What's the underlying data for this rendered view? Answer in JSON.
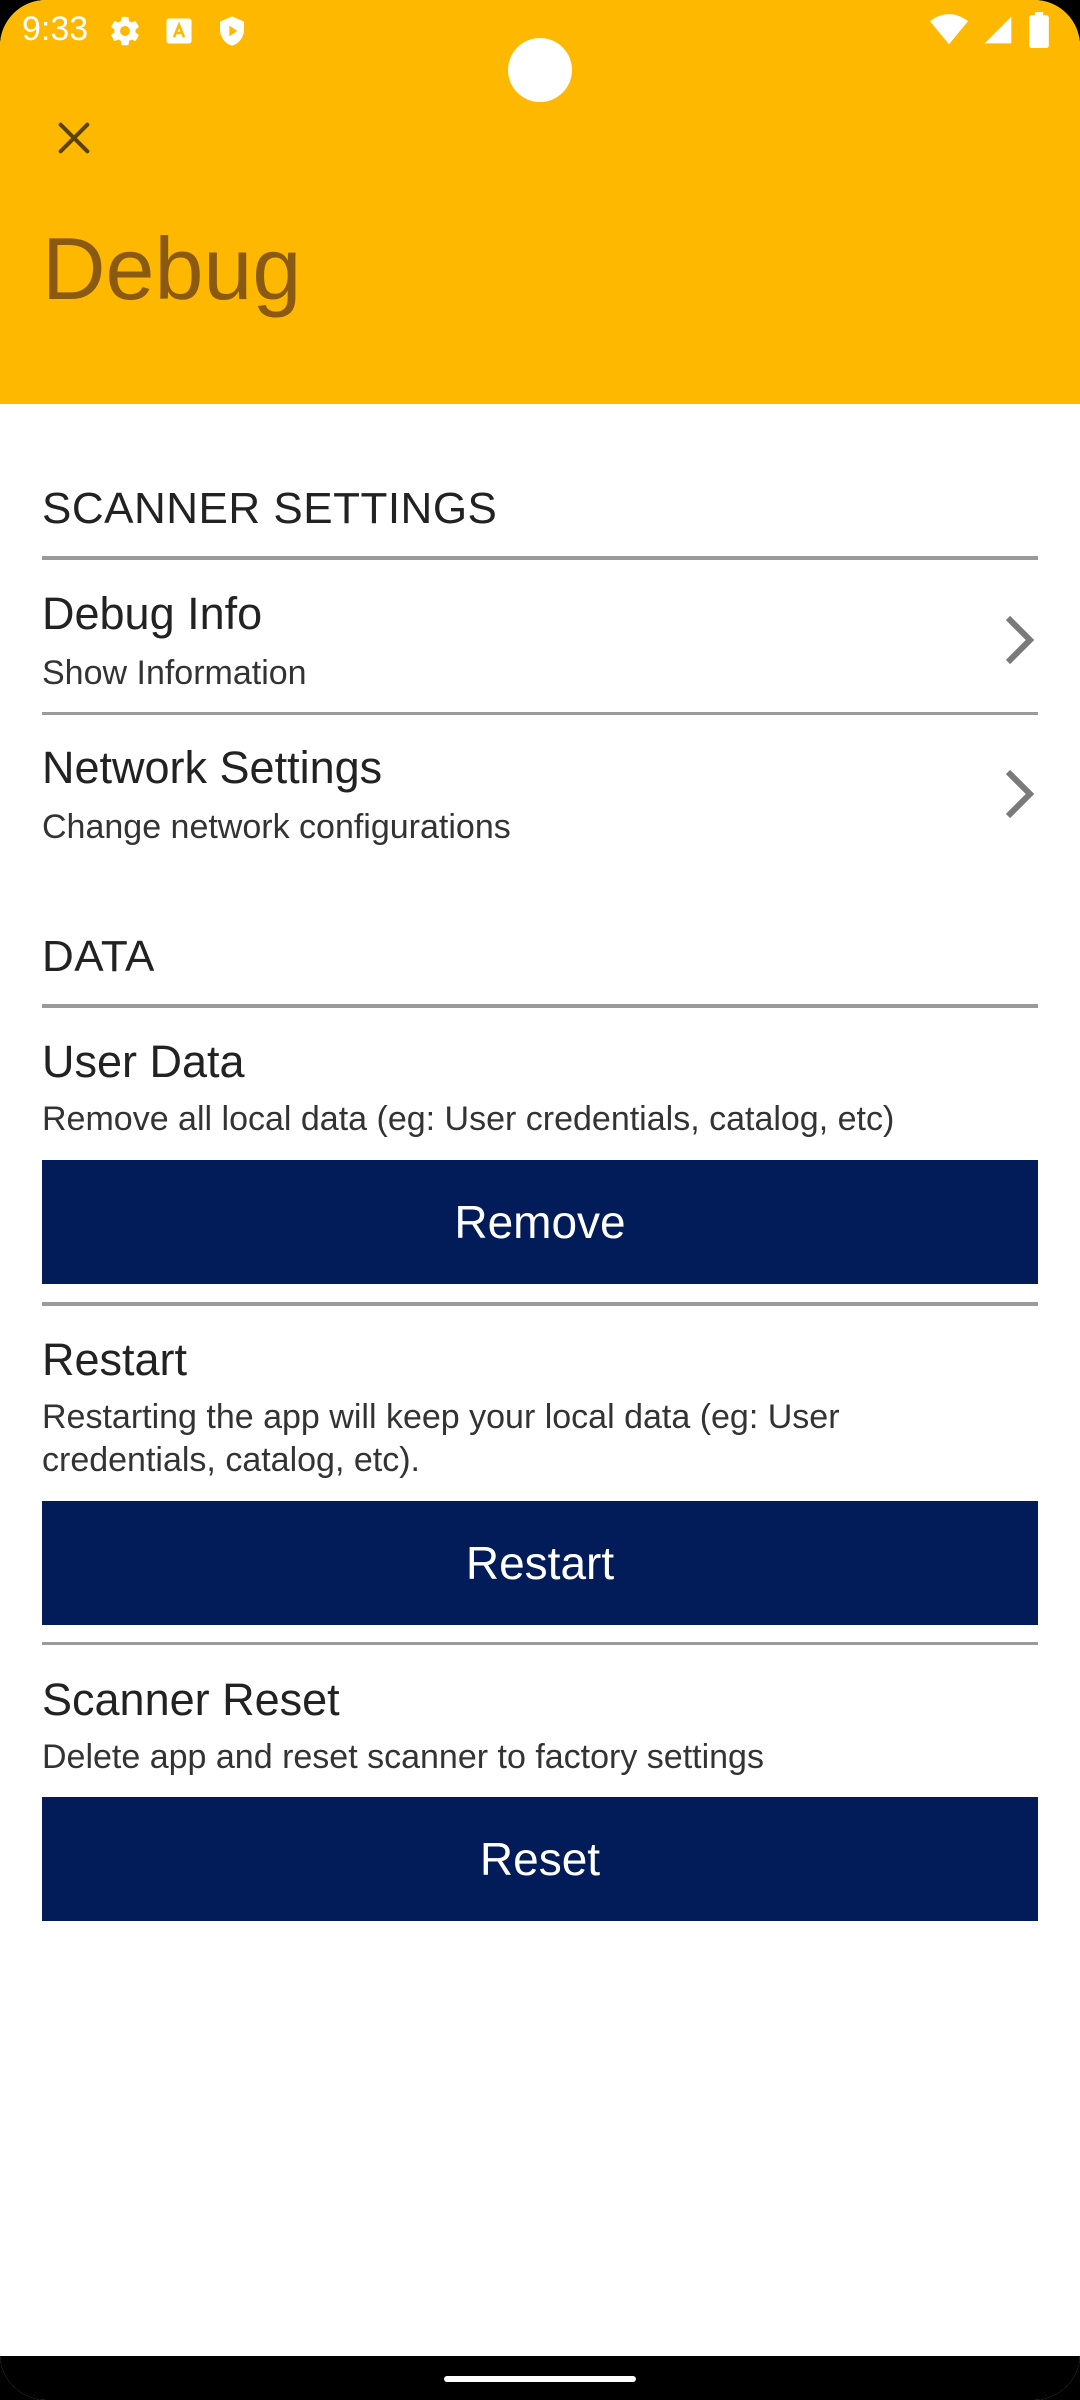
{
  "status_bar": {
    "time": "9:33",
    "left_icons": [
      "settings-icon",
      "font-icon",
      "shield-play-icon"
    ],
    "right_icons": [
      "wifi-icon",
      "signal-icon",
      "battery-icon"
    ]
  },
  "app_bar": {
    "title": "Debug",
    "close_icon": "close-icon",
    "background": "#FFB800",
    "title_color": "#8A5A12"
  },
  "sections": {
    "scanner_settings": {
      "header": "SCANNER SETTINGS",
      "items": [
        {
          "title": "Debug Info",
          "subtitle": "Show Information"
        },
        {
          "title": "Network Settings",
          "subtitle": "Change network configurations"
        }
      ]
    },
    "data": {
      "header": "DATA",
      "user_data": {
        "title": "User Data",
        "subtitle": "Remove all local data (eg: User credentials, catalog, etc)",
        "button": "Remove"
      },
      "restart": {
        "title": "Restart",
        "subtitle": "Restarting the app will keep your local data (eg: User credentials, catalog, etc).",
        "button": "Restart"
      },
      "scanner_reset": {
        "title": "Scanner Reset",
        "subtitle": "Delete app and reset scanner to factory settings",
        "button": "Reset"
      }
    }
  },
  "colors": {
    "button_bg": "#021C5A",
    "button_text": "#FFFFFF",
    "divider": "#9A9A9A"
  }
}
